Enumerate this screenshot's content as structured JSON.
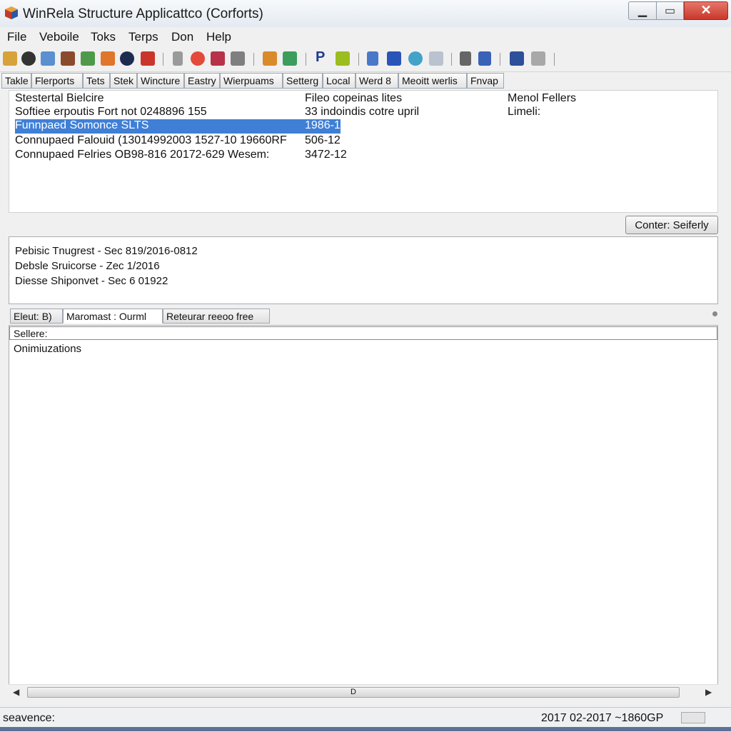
{
  "window": {
    "title": "WinRela Structure Applicattco (Corforts)",
    "minimize_glyph": "▁",
    "maximize_glyph": "▭",
    "close_glyph": "✕"
  },
  "menu": [
    "File",
    "Veboile",
    "Toks",
    "Terps",
    "Don",
    "Help"
  ],
  "toolbar_icons": [
    "gear-icon",
    "disc-icon",
    "lock-icon",
    "tree-icon",
    "tool-icon",
    "palette-icon",
    "globe-icon",
    "chart-icon",
    "pencil-icon",
    "refresh-icon",
    "puzzle-icon",
    "pen-icon",
    "image-icon",
    "monitor-icon",
    "p-icon",
    "picture-icon",
    "document-icon",
    "arrow-down-icon",
    "globe-small-icon",
    "window-icon",
    "cursor-icon",
    "page-icon",
    "network-icon",
    "printer-icon"
  ],
  "tabs": [
    "Takle",
    "Flerports",
    "Tets",
    "Stek",
    "Wincture",
    "Eastry",
    "Wierpuams",
    "Setterg",
    "Local",
    "Werd 8",
    "Meoitt werlis",
    "Fnvap"
  ],
  "table": {
    "headers": [
      "Stestertal Bielcire",
      "Fileo copeinas lites",
      "Menol Fellers"
    ],
    "rows": [
      [
        "Softiee erpoutis Fort not 0248896 155",
        "33 indoindis cotre upril",
        "Limeli:"
      ],
      [
        "Funnpaed Somonce SLTS",
        "1986-1",
        ""
      ],
      [
        "Connupaed Falouid (13014992003 1527-10 19660RF",
        "506-12",
        ""
      ],
      [
        "Connupaed Felries OB98-816 20172-629 Wesem:",
        "3472-12",
        ""
      ]
    ]
  },
  "settings_button": "Conter: Seiferly",
  "log": [
    "Pebisic Tnugrest - Sec 819/2016-0812",
    "Debsle Sruicorse - Zec 1/2016",
    "Diesse Shiponvet - Sec 6 01922"
  ],
  "subtabs": [
    "Eleut: B)",
    "Maromast : Ourml",
    "Reteurar reeoo free"
  ],
  "input_value": "Sellere:",
  "body_text": "Onimiuzations",
  "scrollbar": {
    "left_arrow": "◀",
    "right_arrow": "▶",
    "thumb_label": "D"
  },
  "status": {
    "left": "seavence:",
    "right": "2017 02-2017 ~1860GP"
  }
}
